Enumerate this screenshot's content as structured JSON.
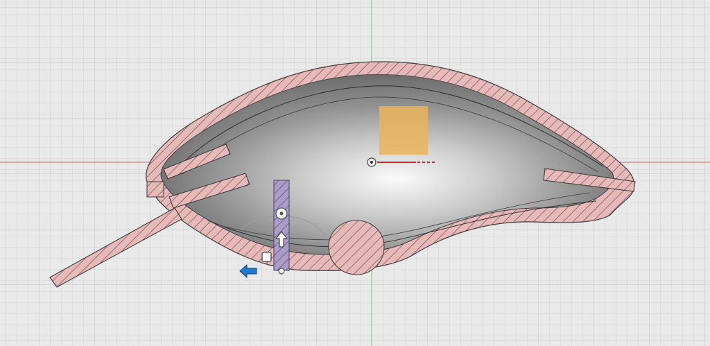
{
  "app": {
    "view": "section-analysis-viewport"
  },
  "colors": {
    "canvas": "#e9e9e9",
    "grid_minor": "#d6d6d6",
    "grid_major": "#c4c4c4",
    "axis_x": "#e05a5a",
    "axis_y": "#5ccf5c",
    "section_fill": "#e8b8b8",
    "section_hatch": "#5a4a4a",
    "manipulator_fill": "#a99ac8",
    "sketch_plane": "#e9b45a",
    "arrow_blue": "#1f7ad1"
  },
  "icons": {
    "origin": "origin-point-icon",
    "rotate_handle": "rotate-handle-icon",
    "push_pull": "up-arrow-icon",
    "move_left": "left-arrow-icon",
    "square_handle": "square-handle-icon"
  }
}
